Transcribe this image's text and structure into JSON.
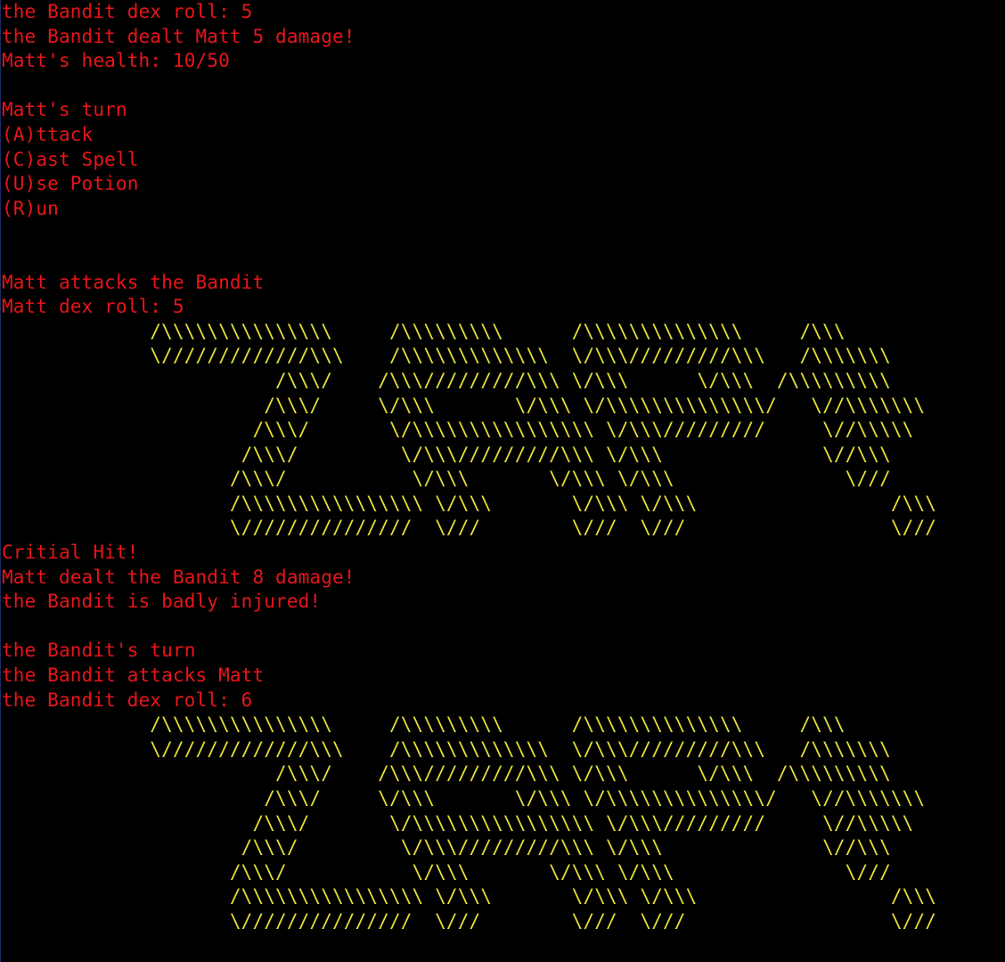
{
  "colors": {
    "background": "#000000",
    "message_text": "#e8151a",
    "ascii_art": "#e6df36"
  },
  "log": {
    "bandit_dex_roll_1": "the Bandit dex roll: 5",
    "bandit_dealt": "the Bandit dealt Matt 5 damage!",
    "matt_health": "Matt's health: 10/50",
    "matt_turn": "Matt's turn",
    "menu": {
      "attack": "(A)ttack",
      "cast_spell": "(C)ast Spell",
      "use_potion": "(U)se Potion",
      "run": "(R)un"
    },
    "matt_attacks": "Matt attacks the Bandit",
    "matt_dex_roll": "Matt dex roll: 5",
    "critical_hit": "Critial Hit!",
    "matt_dealt": "Matt dealt the Bandit 8 damage!",
    "bandit_injured": "the Bandit is badly injured!",
    "bandit_turn": "the Bandit's turn",
    "bandit_attacks": "the Bandit attacks Matt",
    "bandit_dex_roll_2": "the Bandit dex roll: 6"
  },
  "zap_art": [
    "             /\\\\\\\\\\\\\\\\\\\\\\\\\\\\\\     /\\\\\\\\\\\\\\\\\\      /\\\\\\\\\\\\\\\\\\\\\\\\\\\\     /\\\\\\",
    "             \\/////////////\\\\\\    /\\\\\\\\\\\\\\\\\\\\\\\\\\  \\/\\\\\\/////////\\\\\\   /\\\\\\\\\\\\\\",
    "                        /\\\\\\/    /\\\\\\/////////\\\\\\ \\/\\\\\\      \\/\\\\\\  /\\\\\\\\\\\\\\\\\\",
    "                       /\\\\\\/     \\/\\\\\\       \\/\\\\\\ \\/\\\\\\\\\\\\\\\\\\\\\\\\\\\\/   \\//\\\\\\\\\\\\\\",
    "                      /\\\\\\/       \\/\\\\\\\\\\\\\\\\\\\\\\\\\\\\\\\\ \\/\\\\\\/////////     \\//\\\\\\\\\\",
    "                     /\\\\\\/         \\/\\\\\\/////////\\\\\\ \\/\\\\\\              \\//\\\\\\",
    "                    /\\\\\\/           \\/\\\\\\       \\/\\\\\\ \\/\\\\\\               \\///",
    "                    /\\\\\\\\\\\\\\\\\\\\\\\\\\\\\\\\ \\/\\\\\\       \\/\\\\\\ \\/\\\\\\                 /\\\\\\",
    "                    \\///////////////  \\///        \\///  \\///                  \\///"
  ]
}
